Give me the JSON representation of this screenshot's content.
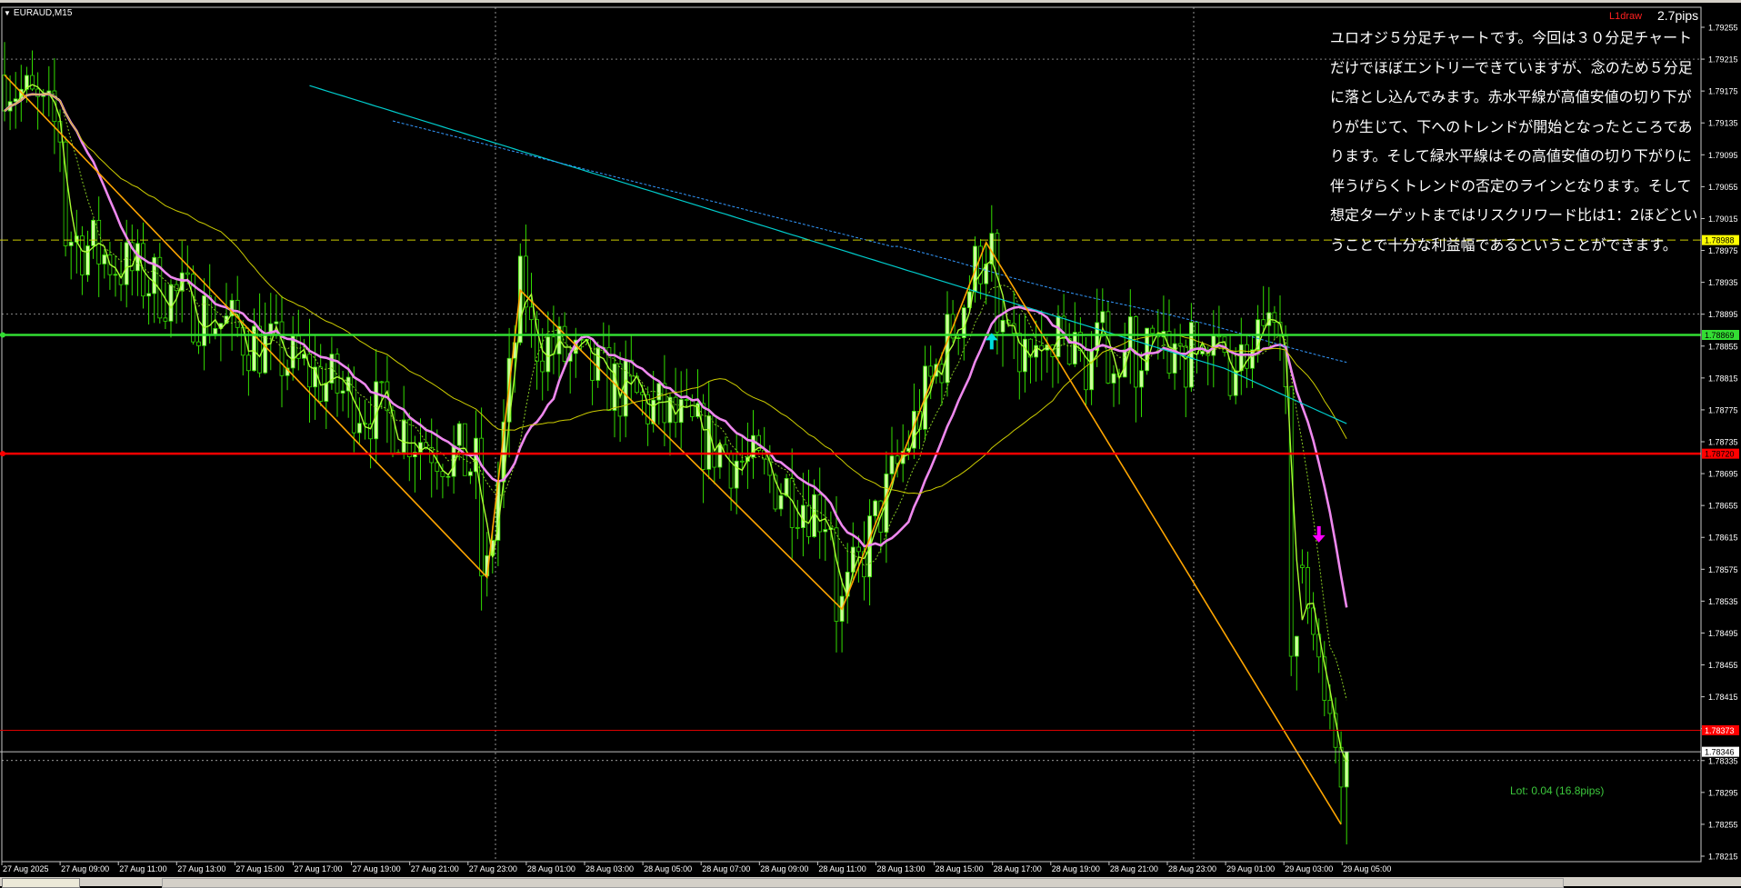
{
  "window": {
    "symbol": "EURAUD,M15"
  },
  "note_text": "ユロオジ５分足チャートです。今回は３０分足チャートだけでほぼエントリーできていますが、念のため５分足に落とし込んでみます。赤水平線が高値安値の切り下がりが生じて、下へのトレンドが開始となったところであります。そして緑水平線はその高値安値の切り下がりに伴うげらくトレンドの否定のラインとなります。そして想定ターゲットまではリスクリワード比は1：2ほどということで十分な利益幅であるということができます。",
  "indicator": {
    "label": "L1draw",
    "spread": "2.7pips",
    "lot": "Lot: 0.04 (16.8pips)"
  },
  "colors": {
    "bull_body": "#ccff99",
    "wick": "#33dd00",
    "bear_body": "#000000",
    "ma_fast": "#aaff33",
    "ma_mid": "#ee88ee",
    "ma_slow1": "#cccc00",
    "ma_slow2": "#00cccc",
    "zigzag": "#ffa500",
    "green_line": "#33dd33",
    "red_line": "#ff0000",
    "dashed_yellow": "#cccc00",
    "grid": "#d0d0d0",
    "up_arrow": "#00dddd",
    "down_arrow": "#ff00ff"
  },
  "price_levels": {
    "green": "1.78869",
    "red": "1.78720",
    "dashed_yellow": "1.78988",
    "red_target": "1.78373",
    "current": "1.78346"
  },
  "chart_data": {
    "type": "candlestick",
    "price_axis": [
      "1.79255",
      "1.79215",
      "1.79175",
      "1.79135",
      "1.79095",
      "1.79055",
      "1.79015",
      "1.78975",
      "1.78935",
      "1.78895",
      "1.78855",
      "1.78815",
      "1.78775",
      "1.78735",
      "1.78695",
      "1.78655",
      "1.78615",
      "1.78575",
      "1.78535",
      "1.78495",
      "1.78455",
      "1.78415",
      "1.78375",
      "1.78335",
      "1.78295",
      "1.78255",
      "1.78215"
    ],
    "ylim": [
      1.78215,
      1.79255
    ],
    "time_axis": [
      "27 Aug 2025",
      "27 Aug 09:00",
      "27 Aug 11:00",
      "27 Aug 13:00",
      "27 Aug 15:00",
      "27 Aug 17:00",
      "27 Aug 19:00",
      "27 Aug 21:00",
      "27 Aug 23:00",
      "28 Aug 01:00",
      "28 Aug 03:00",
      "28 Aug 05:00",
      "28 Aug 07:00",
      "28 Aug 09:00",
      "28 Aug 11:00",
      "28 Aug 13:00",
      "28 Aug 15:00",
      "28 Aug 17:00",
      "28 Aug 19:00",
      "28 Aug 21:00",
      "28 Aug 23:00",
      "29 Aug 01:00",
      "29 Aug 03:00",
      "29 Aug 05:00"
    ],
    "zigzag_points": [
      [
        0,
        1.79195
      ],
      [
        87,
        1.78565
      ],
      [
        93,
        1.78925
      ],
      [
        151,
        1.78525
      ],
      [
        177,
        1.78985
      ],
      [
        241,
        1.78255
      ]
    ],
    "horizontal_lines": [
      1.78869,
      1.7872,
      1.78988,
      1.78373,
      1.78346
    ],
    "signals": [
      {
        "type": "buy_arrow",
        "bar": 178,
        "price": 1.7886
      },
      {
        "type": "sell_arrow",
        "bar": 237,
        "price": 1.7862
      }
    ]
  }
}
